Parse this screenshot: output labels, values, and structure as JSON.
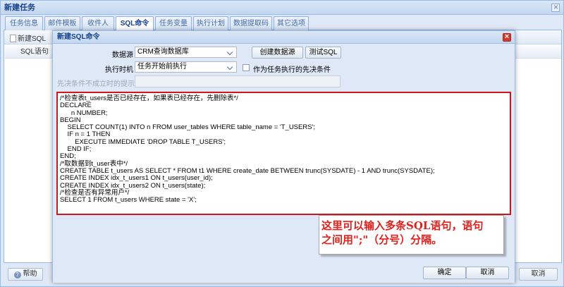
{
  "outer_window": {
    "title": "新建任务",
    "tabs": [
      "任务信息",
      "邮件模板",
      "收件人",
      "SQL命令",
      "任务变量",
      "执行计划",
      "数据提取码",
      "其它选项"
    ],
    "active_tab": "SQL命令",
    "toolbar": {
      "new_sql": "新建SQL"
    },
    "grid": {
      "sql_column": "SQL语句"
    },
    "footer": {
      "help": "帮助",
      "cancel": "取消"
    }
  },
  "dialog": {
    "title": "新建SQL命令",
    "datasource": {
      "label": "数据源",
      "value": "CRM查询数据库",
      "create_button": "创建数据源",
      "test_button": "测试SQL"
    },
    "exec_time": {
      "label": "执行时机",
      "value": "任务开始前执行",
      "checkbox_label": "作为任务执行的先决条件",
      "checked": false
    },
    "precondition_hint": {
      "label": "先决条件不成立时的提示语",
      "value": ""
    },
    "sql_lines": [
      "/*检查表t_users是否已经存在，如果表已经存在，先删除表*/",
      "DECLARE",
      "      n NUMBER;",
      "BEGIN",
      "    SELECT COUNT(1) INTO n FROM user_tables WHERE table_name = 'T_USERS';",
      "    IF n = 1 THEN",
      "        EXECUTE IMMEDIATE 'DROP TABLE T_USERS';",
      "    END IF;",
      "END;",
      "/*取数据到t_user表中*/",
      "CREATE TABLE t_users AS SELECT * FROM t1 WHERE create_date BETWEEN trunc(SYSDATE) - 1 AND trunc(SYSDATE);",
      "CREATE INDEX idx_t_users1 ON t_users(user_id);",
      "CREATE INDEX idx_t_users2 ON t_users(state);",
      "/*检查是否有异常用户*/",
      "SELECT 1 FROM t_users WHERE state = 'X';"
    ],
    "callout": {
      "line1": "这里可以输入多条SQL语句，语句",
      "line2": "之间用\";\"（分号）分隔。"
    },
    "footer": {
      "ok": "确定",
      "cancel": "取消"
    }
  },
  "colors": {
    "highlight_border": "#d3151b",
    "callout_text": "#e0211d",
    "title_text": "#15428b"
  }
}
